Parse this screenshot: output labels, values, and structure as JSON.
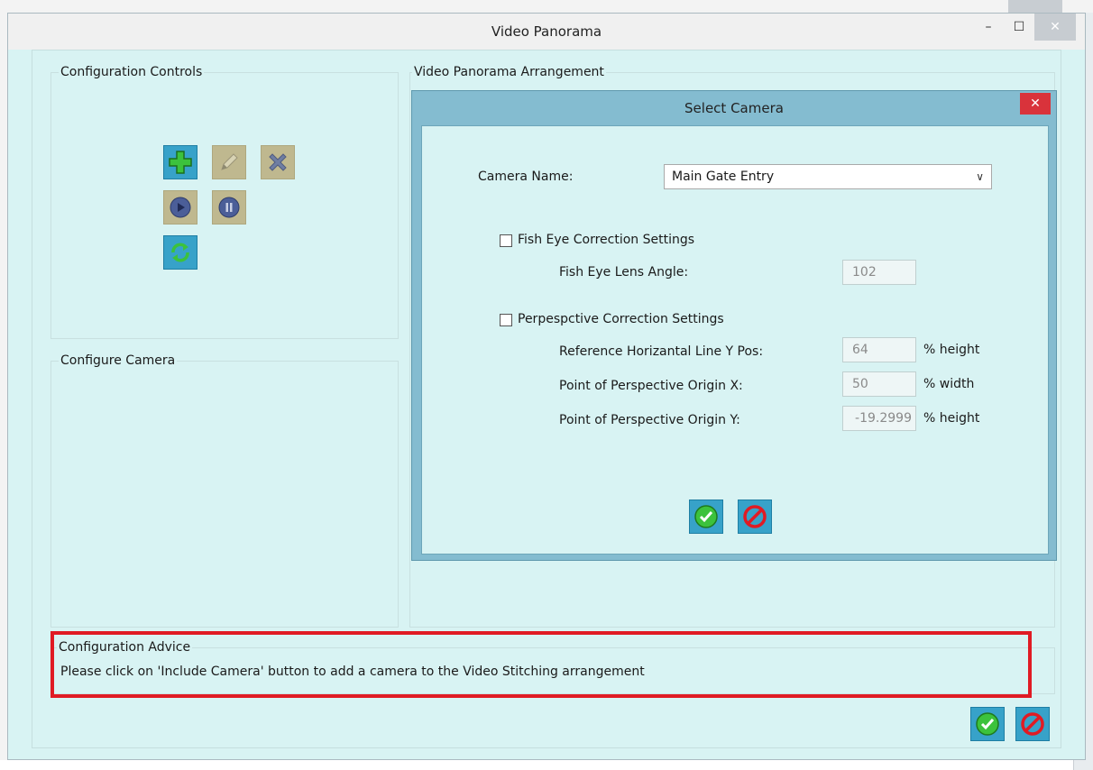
{
  "window": {
    "title": "Video Panorama",
    "minimize_symbol": "–",
    "maximize_symbol": "☐",
    "close_symbol": "✕"
  },
  "config_controls": {
    "title": "Configuration Controls",
    "buttons": [
      {
        "name": "include-camera-button",
        "icon": "plus-icon",
        "enabled": true
      },
      {
        "name": "edit-camera-button",
        "icon": "pencil-icon",
        "enabled": false
      },
      {
        "name": "remove-camera-button",
        "icon": "x-icon",
        "enabled": false
      },
      {
        "name": "play-button",
        "icon": "play-icon",
        "enabled": false
      },
      {
        "name": "pause-button",
        "icon": "pause-icon",
        "enabled": false
      },
      {
        "name": "refresh-button",
        "icon": "refresh-icon",
        "enabled": true
      }
    ]
  },
  "configure_camera": {
    "title": "Configure Camera"
  },
  "arrangement": {
    "title": "Video Panorama Arrangement"
  },
  "dialog": {
    "title": "Select Camera",
    "close_symbol": "✕",
    "camera_name_label": "Camera Name:",
    "camera_name_value": "Main Gate Entry",
    "fisheye_checkbox_label": "Fish Eye Correction Settings",
    "fisheye_checked": false,
    "fisheye_angle_label": "Fish  Eye Lens Angle:",
    "fisheye_angle_value": "102",
    "perspective_checkbox_label": "Perpespctive Correction Settings",
    "perspective_checked": false,
    "ref_line_label": "Reference Horizantal Line Y Pos:",
    "ref_line_value": "64",
    "ref_line_unit": "% height",
    "origin_x_label": "Point of Perspective Origin X:",
    "origin_x_value": "50",
    "origin_x_unit": "% width",
    "origin_y_label": "Point of Perspective Origin Y:",
    "origin_y_value": "-19.2999",
    "origin_y_unit": "% height"
  },
  "advice": {
    "title": "Configuration Advice",
    "text": "Please click on 'Include Camera' button to add a camera to the Video Stitching arrangement"
  },
  "colors": {
    "panel_bg": "#d8f3f3",
    "dialog_frame": "#84bcd0",
    "active_button": "#37a2c9",
    "disabled_button": "#bfb88f",
    "highlight_border": "#e01b24"
  }
}
